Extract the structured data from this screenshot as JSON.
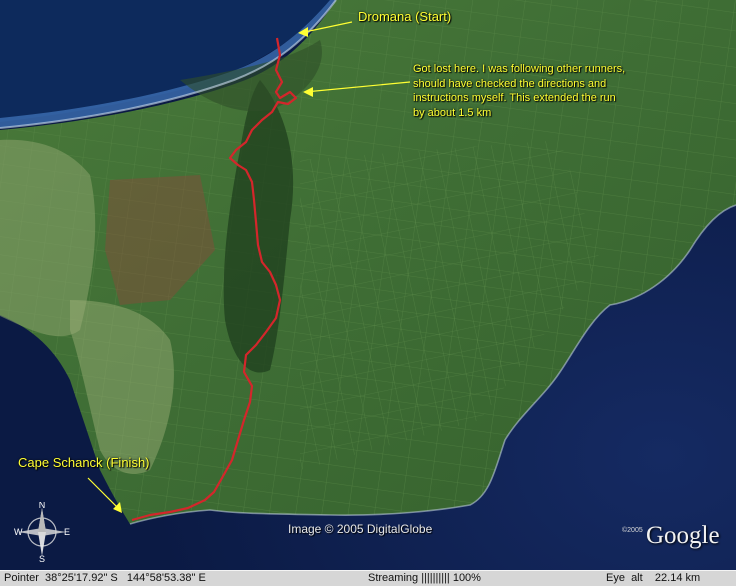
{
  "map": {
    "annotations": {
      "start": "Dromana (Start)",
      "finish": "Cape Schanck (Finish)",
      "note_lines": [
        "Got lost here. I was following other runners,",
        "should have checked the directions and",
        "instructions myself.   This extended the run",
        "by about 1.5 km"
      ]
    },
    "route_color": "#d4262b",
    "annotation_color": "#ffff33",
    "credit": "Image © 2005 DigitalGlobe",
    "logo": {
      "year": "©2005",
      "text": "Google"
    },
    "compass_letters": {
      "north": "N",
      "south": "S",
      "east": "E",
      "west": "W"
    }
  },
  "status_bar": {
    "pointer": "Pointer  38°25'17.92\" S   144°58'53.38\" E",
    "streaming": "Streaming |||||||||| 100%",
    "eye_alt": "Eye  alt    22.14 km"
  }
}
